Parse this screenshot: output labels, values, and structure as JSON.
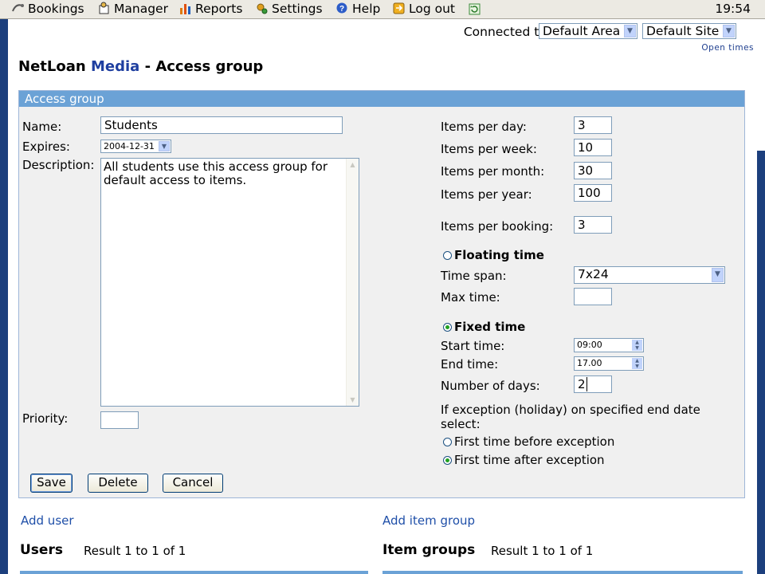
{
  "menu": {
    "items": [
      {
        "id": "bookings",
        "label": "Bookings",
        "icon": "bookings-icon"
      },
      {
        "id": "manager",
        "label": "Manager",
        "icon": "manager-icon"
      },
      {
        "id": "reports",
        "label": "Reports",
        "icon": "reports-icon"
      },
      {
        "id": "settings",
        "label": "Settings",
        "icon": "settings-icon"
      },
      {
        "id": "help",
        "label": "Help",
        "icon": "help-icon"
      },
      {
        "id": "logout",
        "label": "Log out",
        "icon": "logout-icon"
      }
    ],
    "refresh_icon": "refresh-icon",
    "clock": "19:54"
  },
  "connection": {
    "label": "Connected to:",
    "area": "Default Area",
    "site": "Default Site",
    "open_times": "Open times"
  },
  "page": {
    "title_prefix": "NetLoan",
    "title_brand": "Media",
    "title_suffix": "- Access group"
  },
  "form": {
    "header": "Access group",
    "name_label": "Name:",
    "name_value": "Students",
    "expires_label": "Expires:",
    "expires_value": "2004-12-31",
    "description_label": "Description:",
    "description_value": "All students use this access group for default access to items.",
    "priority_label": "Priority:",
    "priority_value": "",
    "items_per_day_label": "Items per day:",
    "items_per_day": "3",
    "items_per_week_label": "Items per week:",
    "items_per_week": "10",
    "items_per_month_label": "Items per month:",
    "items_per_month": "30",
    "items_per_year_label": "Items per year:",
    "items_per_year": "100",
    "items_per_booking_label": "Items per booking:",
    "items_per_booking": "3",
    "floating_label": "Floating time",
    "floating_selected": false,
    "time_span_label": "Time span:",
    "time_span_value": "7x24",
    "max_time_label": "Max time:",
    "max_time_value": "",
    "fixed_label": "Fixed time",
    "fixed_selected": true,
    "start_time_label": "Start time:",
    "start_time": "09:00",
    "end_time_label": "End time:",
    "end_time": "17.00",
    "days_label": "Number of days:",
    "days_value": "2",
    "exception_label": "If exception (holiday) on specified end date select:",
    "exception_before": "First time before exception",
    "exception_after": "First time after exception",
    "exception_selected": "after",
    "buttons": {
      "save": "Save",
      "delete": "Delete",
      "cancel": "Cancel"
    }
  },
  "footer": {
    "add_user": "Add user",
    "add_item_group": "Add item group",
    "users_title": "Users",
    "users_result": "Result 1 to 1 of 1",
    "item_groups_title": "Item groups",
    "item_groups_result": "Result 1 to 1 of 1"
  },
  "colors": {
    "accent": "#6ba2d6",
    "brand": "#1f3fa0",
    "background": "#1c3f7d"
  }
}
